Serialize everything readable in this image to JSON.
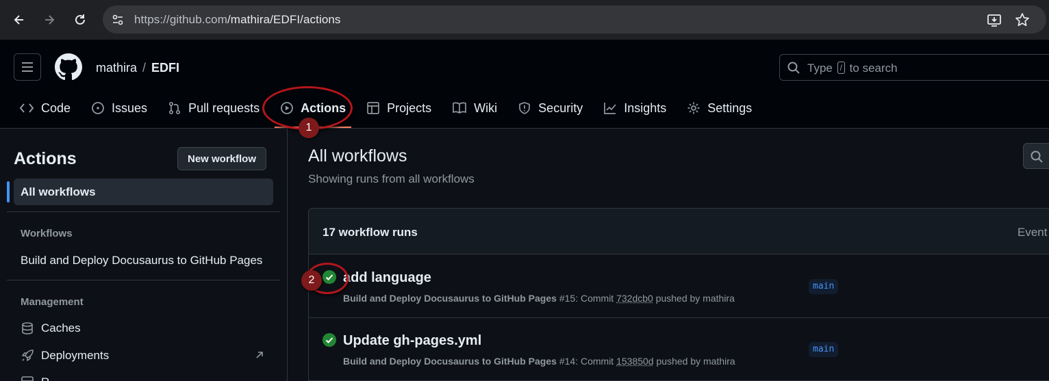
{
  "browser": {
    "url_host": "https://github.com",
    "url_path": "/mathira/EDFI/actions"
  },
  "header": {
    "owner": "mathira",
    "separator": "/",
    "repo": "EDFI",
    "search_prefix": "Type",
    "search_key": "/",
    "search_suffix": "to search"
  },
  "tabs": [
    {
      "label": "Code",
      "icon": "code-icon"
    },
    {
      "label": "Issues",
      "icon": "issue-icon"
    },
    {
      "label": "Pull requests",
      "icon": "pull-request-icon"
    },
    {
      "label": "Actions",
      "icon": "play-icon",
      "active": true
    },
    {
      "label": "Projects",
      "icon": "table-icon"
    },
    {
      "label": "Wiki",
      "icon": "book-icon"
    },
    {
      "label": "Security",
      "icon": "shield-icon"
    },
    {
      "label": "Insights",
      "icon": "graph-icon"
    },
    {
      "label": "Settings",
      "icon": "gear-icon"
    }
  ],
  "annotations": {
    "badge1": "1",
    "badge2": "2",
    "color": "#b3161c"
  },
  "sidebar": {
    "title": "Actions",
    "new_workflow": "New workflow",
    "active_item": "All workflows",
    "workflows_heading": "Workflows",
    "workflow_item": "Build and Deploy Docusaurus to GitHub Pages",
    "management_heading": "Management",
    "caches": "Caches",
    "deployments": "Deployments",
    "cut_item": "R"
  },
  "main": {
    "title": "All workflows",
    "subtitle": "Showing runs from all workflows",
    "runs_count": "17 workflow runs",
    "event_label": "Event",
    "runs": [
      {
        "title": "add language",
        "workflow": "Build and Deploy Docusaurus to GitHub Pages",
        "number": "#15",
        "commit_label": "Commit",
        "sha": "732dcb0",
        "pushed_by": "pushed by mathira",
        "branch": "main",
        "status": "success"
      },
      {
        "title": "Update gh-pages.yml",
        "workflow": "Build and Deploy Docusaurus to GitHub Pages",
        "number": "#14",
        "commit_label": "Commit",
        "sha": "153850d",
        "pushed_by": "pushed by mathira",
        "branch": "main",
        "status": "success"
      }
    ]
  },
  "colors": {
    "accent_blue": "#4493f8",
    "success_green": "#238636",
    "tab_underline": "#f78166"
  }
}
